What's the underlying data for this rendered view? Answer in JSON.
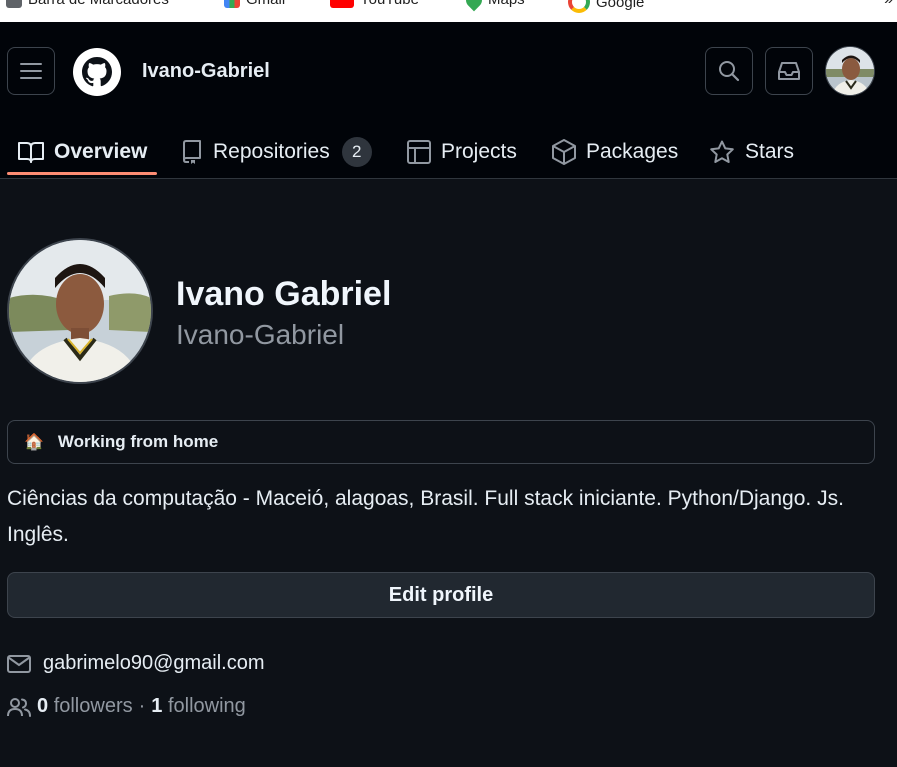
{
  "bookmarks": [
    {
      "label": "Barra de Marcadores",
      "icon": "folder-icon"
    },
    {
      "label": "Gmail",
      "icon": "gmail-icon"
    },
    {
      "label": "YouTube",
      "icon": "youtube-icon"
    },
    {
      "label": "Maps",
      "icon": "maps-icon"
    },
    {
      "label": "Google",
      "icon": "google-icon"
    }
  ],
  "bookmarks_more": "»",
  "header": {
    "username": "Ivano-Gabriel"
  },
  "tabs": [
    {
      "label": "Overview",
      "icon": "book-icon",
      "selected": true
    },
    {
      "label": "Repositories",
      "icon": "repo-icon",
      "count": "2"
    },
    {
      "label": "Projects",
      "icon": "table-icon"
    },
    {
      "label": "Packages",
      "icon": "package-icon"
    },
    {
      "label": "Stars",
      "icon": "star-icon"
    }
  ],
  "profile": {
    "full_name": "Ivano Gabriel",
    "login": "Ivano-Gabriel",
    "status": "Working from home",
    "status_emoji": "🏠",
    "bio": "Ciências da computação - Maceió, alagoas, Brasil. Full stack iniciante. Python/Django. Js. Inglês.",
    "edit_label": "Edit profile",
    "email": "gabrimelo90@gmail.com",
    "followers_count": "0",
    "followers_label": "followers",
    "separator": "·",
    "following_count": "1",
    "following_label": "following"
  },
  "colors": {
    "background": "#0d1117",
    "header_bg": "#010409",
    "accent_underline": "#fd8c73",
    "border": "#3d444d",
    "muted_text": "#9198a1"
  }
}
